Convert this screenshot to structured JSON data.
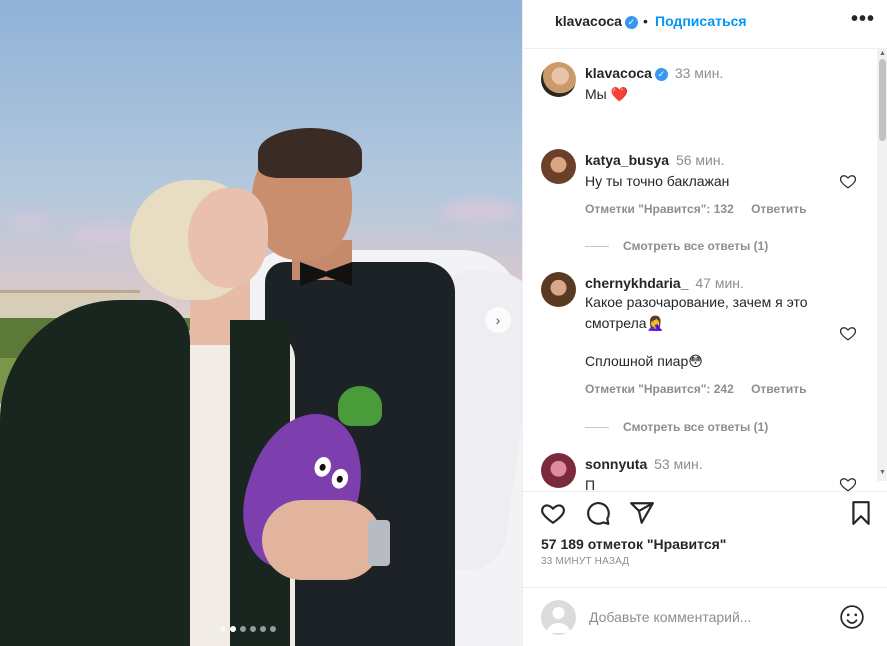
{
  "post": {
    "username": "klavacoca",
    "separator": "•",
    "follow_label": "Подписаться",
    "more_label": "•••",
    "caption": {
      "username": "klavacoca",
      "time": "33 мин.",
      "text": "Мы ❤️"
    },
    "photo": {
      "next_arrow": "›",
      "dot_count": 6,
      "active_dot": 1
    }
  },
  "comments": [
    {
      "username": "katya_busya",
      "time": "56 мин.",
      "text": "Ну ты точно баклажан",
      "likes_label": "Отметки \"Нравится\": 132",
      "reply_label": "Ответить",
      "view_replies": "Смотреть все ответы (1)"
    },
    {
      "username": "chernykhdaria_",
      "time": "47 мин.",
      "text": "Какое разочарование, зачем я это смотрела🤦‍♀️",
      "text2": "Сплошной пиар😳",
      "likes_label": "Отметки \"Нравится\": 242",
      "reply_label": "Ответить",
      "view_replies": "Смотреть все ответы (1)"
    },
    {
      "username": "sonnyuta",
      "time": "53 мин.",
      "text": "П"
    }
  ],
  "actions": {
    "likes_text": "57 189 отметок \"Нравится\"",
    "time_ago": "33 МИНУТ НАЗАД"
  },
  "add_comment": {
    "placeholder": "Добавьте комментарий..."
  },
  "colors": {
    "accent": "#0095f6",
    "verified": "#3897f0",
    "heart": "#ed4956",
    "muted": "#8e8e8e"
  }
}
